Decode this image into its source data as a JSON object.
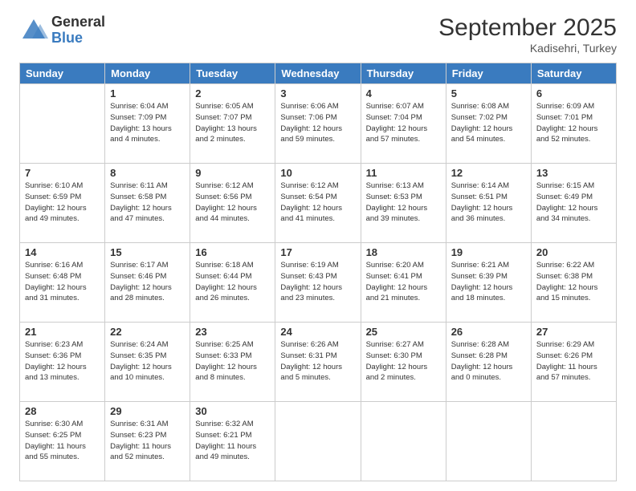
{
  "logo": {
    "general": "General",
    "blue": "Blue"
  },
  "title": "September 2025",
  "subtitle": "Kadisehri, Turkey",
  "days_of_week": [
    "Sunday",
    "Monday",
    "Tuesday",
    "Wednesday",
    "Thursday",
    "Friday",
    "Saturday"
  ],
  "weeks": [
    [
      {
        "day": "",
        "info": ""
      },
      {
        "day": "1",
        "info": "Sunrise: 6:04 AM\nSunset: 7:09 PM\nDaylight: 13 hours\nand 4 minutes."
      },
      {
        "day": "2",
        "info": "Sunrise: 6:05 AM\nSunset: 7:07 PM\nDaylight: 13 hours\nand 2 minutes."
      },
      {
        "day": "3",
        "info": "Sunrise: 6:06 AM\nSunset: 7:06 PM\nDaylight: 12 hours\nand 59 minutes."
      },
      {
        "day": "4",
        "info": "Sunrise: 6:07 AM\nSunset: 7:04 PM\nDaylight: 12 hours\nand 57 minutes."
      },
      {
        "day": "5",
        "info": "Sunrise: 6:08 AM\nSunset: 7:02 PM\nDaylight: 12 hours\nand 54 minutes."
      },
      {
        "day": "6",
        "info": "Sunrise: 6:09 AM\nSunset: 7:01 PM\nDaylight: 12 hours\nand 52 minutes."
      }
    ],
    [
      {
        "day": "7",
        "info": "Sunrise: 6:10 AM\nSunset: 6:59 PM\nDaylight: 12 hours\nand 49 minutes."
      },
      {
        "day": "8",
        "info": "Sunrise: 6:11 AM\nSunset: 6:58 PM\nDaylight: 12 hours\nand 47 minutes."
      },
      {
        "day": "9",
        "info": "Sunrise: 6:12 AM\nSunset: 6:56 PM\nDaylight: 12 hours\nand 44 minutes."
      },
      {
        "day": "10",
        "info": "Sunrise: 6:12 AM\nSunset: 6:54 PM\nDaylight: 12 hours\nand 41 minutes."
      },
      {
        "day": "11",
        "info": "Sunrise: 6:13 AM\nSunset: 6:53 PM\nDaylight: 12 hours\nand 39 minutes."
      },
      {
        "day": "12",
        "info": "Sunrise: 6:14 AM\nSunset: 6:51 PM\nDaylight: 12 hours\nand 36 minutes."
      },
      {
        "day": "13",
        "info": "Sunrise: 6:15 AM\nSunset: 6:49 PM\nDaylight: 12 hours\nand 34 minutes."
      }
    ],
    [
      {
        "day": "14",
        "info": "Sunrise: 6:16 AM\nSunset: 6:48 PM\nDaylight: 12 hours\nand 31 minutes."
      },
      {
        "day": "15",
        "info": "Sunrise: 6:17 AM\nSunset: 6:46 PM\nDaylight: 12 hours\nand 28 minutes."
      },
      {
        "day": "16",
        "info": "Sunrise: 6:18 AM\nSunset: 6:44 PM\nDaylight: 12 hours\nand 26 minutes."
      },
      {
        "day": "17",
        "info": "Sunrise: 6:19 AM\nSunset: 6:43 PM\nDaylight: 12 hours\nand 23 minutes."
      },
      {
        "day": "18",
        "info": "Sunrise: 6:20 AM\nSunset: 6:41 PM\nDaylight: 12 hours\nand 21 minutes."
      },
      {
        "day": "19",
        "info": "Sunrise: 6:21 AM\nSunset: 6:39 PM\nDaylight: 12 hours\nand 18 minutes."
      },
      {
        "day": "20",
        "info": "Sunrise: 6:22 AM\nSunset: 6:38 PM\nDaylight: 12 hours\nand 15 minutes."
      }
    ],
    [
      {
        "day": "21",
        "info": "Sunrise: 6:23 AM\nSunset: 6:36 PM\nDaylight: 12 hours\nand 13 minutes."
      },
      {
        "day": "22",
        "info": "Sunrise: 6:24 AM\nSunset: 6:35 PM\nDaylight: 12 hours\nand 10 minutes."
      },
      {
        "day": "23",
        "info": "Sunrise: 6:25 AM\nSunset: 6:33 PM\nDaylight: 12 hours\nand 8 minutes."
      },
      {
        "day": "24",
        "info": "Sunrise: 6:26 AM\nSunset: 6:31 PM\nDaylight: 12 hours\nand 5 minutes."
      },
      {
        "day": "25",
        "info": "Sunrise: 6:27 AM\nSunset: 6:30 PM\nDaylight: 12 hours\nand 2 minutes."
      },
      {
        "day": "26",
        "info": "Sunrise: 6:28 AM\nSunset: 6:28 PM\nDaylight: 12 hours\nand 0 minutes."
      },
      {
        "day": "27",
        "info": "Sunrise: 6:29 AM\nSunset: 6:26 PM\nDaylight: 11 hours\nand 57 minutes."
      }
    ],
    [
      {
        "day": "28",
        "info": "Sunrise: 6:30 AM\nSunset: 6:25 PM\nDaylight: 11 hours\nand 55 minutes."
      },
      {
        "day": "29",
        "info": "Sunrise: 6:31 AM\nSunset: 6:23 PM\nDaylight: 11 hours\nand 52 minutes."
      },
      {
        "day": "30",
        "info": "Sunrise: 6:32 AM\nSunset: 6:21 PM\nDaylight: 11 hours\nand 49 minutes."
      },
      {
        "day": "",
        "info": ""
      },
      {
        "day": "",
        "info": ""
      },
      {
        "day": "",
        "info": ""
      },
      {
        "day": "",
        "info": ""
      }
    ]
  ]
}
